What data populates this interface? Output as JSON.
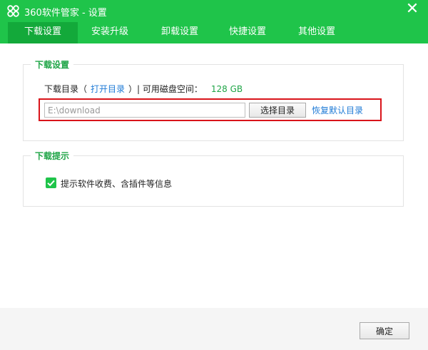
{
  "window": {
    "title": "360软件管家 - 设置"
  },
  "tabs": [
    {
      "label": "下载设置",
      "active": true
    },
    {
      "label": "安装升级"
    },
    {
      "label": "卸载设置"
    },
    {
      "label": "快捷设置"
    },
    {
      "label": "其他设置"
    }
  ],
  "download_settings": {
    "group_title": "下载设置",
    "dir_label_prefix": "下载目录（",
    "open_dir_link": "打开目录",
    "dir_label_suffix": "）| 可用磁盘空间：",
    "free_space": "128 GB",
    "path_value": "E:\\download",
    "choose_dir_button": "选择目录",
    "restore_default_link": "恢复默认目录"
  },
  "download_tips": {
    "group_title": "下载提示",
    "checkbox_label": "提示软件收费、含插件等信息",
    "checked": true
  },
  "footer": {
    "ok_button": "确定"
  },
  "colors": {
    "brand_green": "#1fc44a",
    "active_tab": "#13a93a",
    "link_blue": "#1f7bd6",
    "highlight_red": "#d9141a"
  }
}
